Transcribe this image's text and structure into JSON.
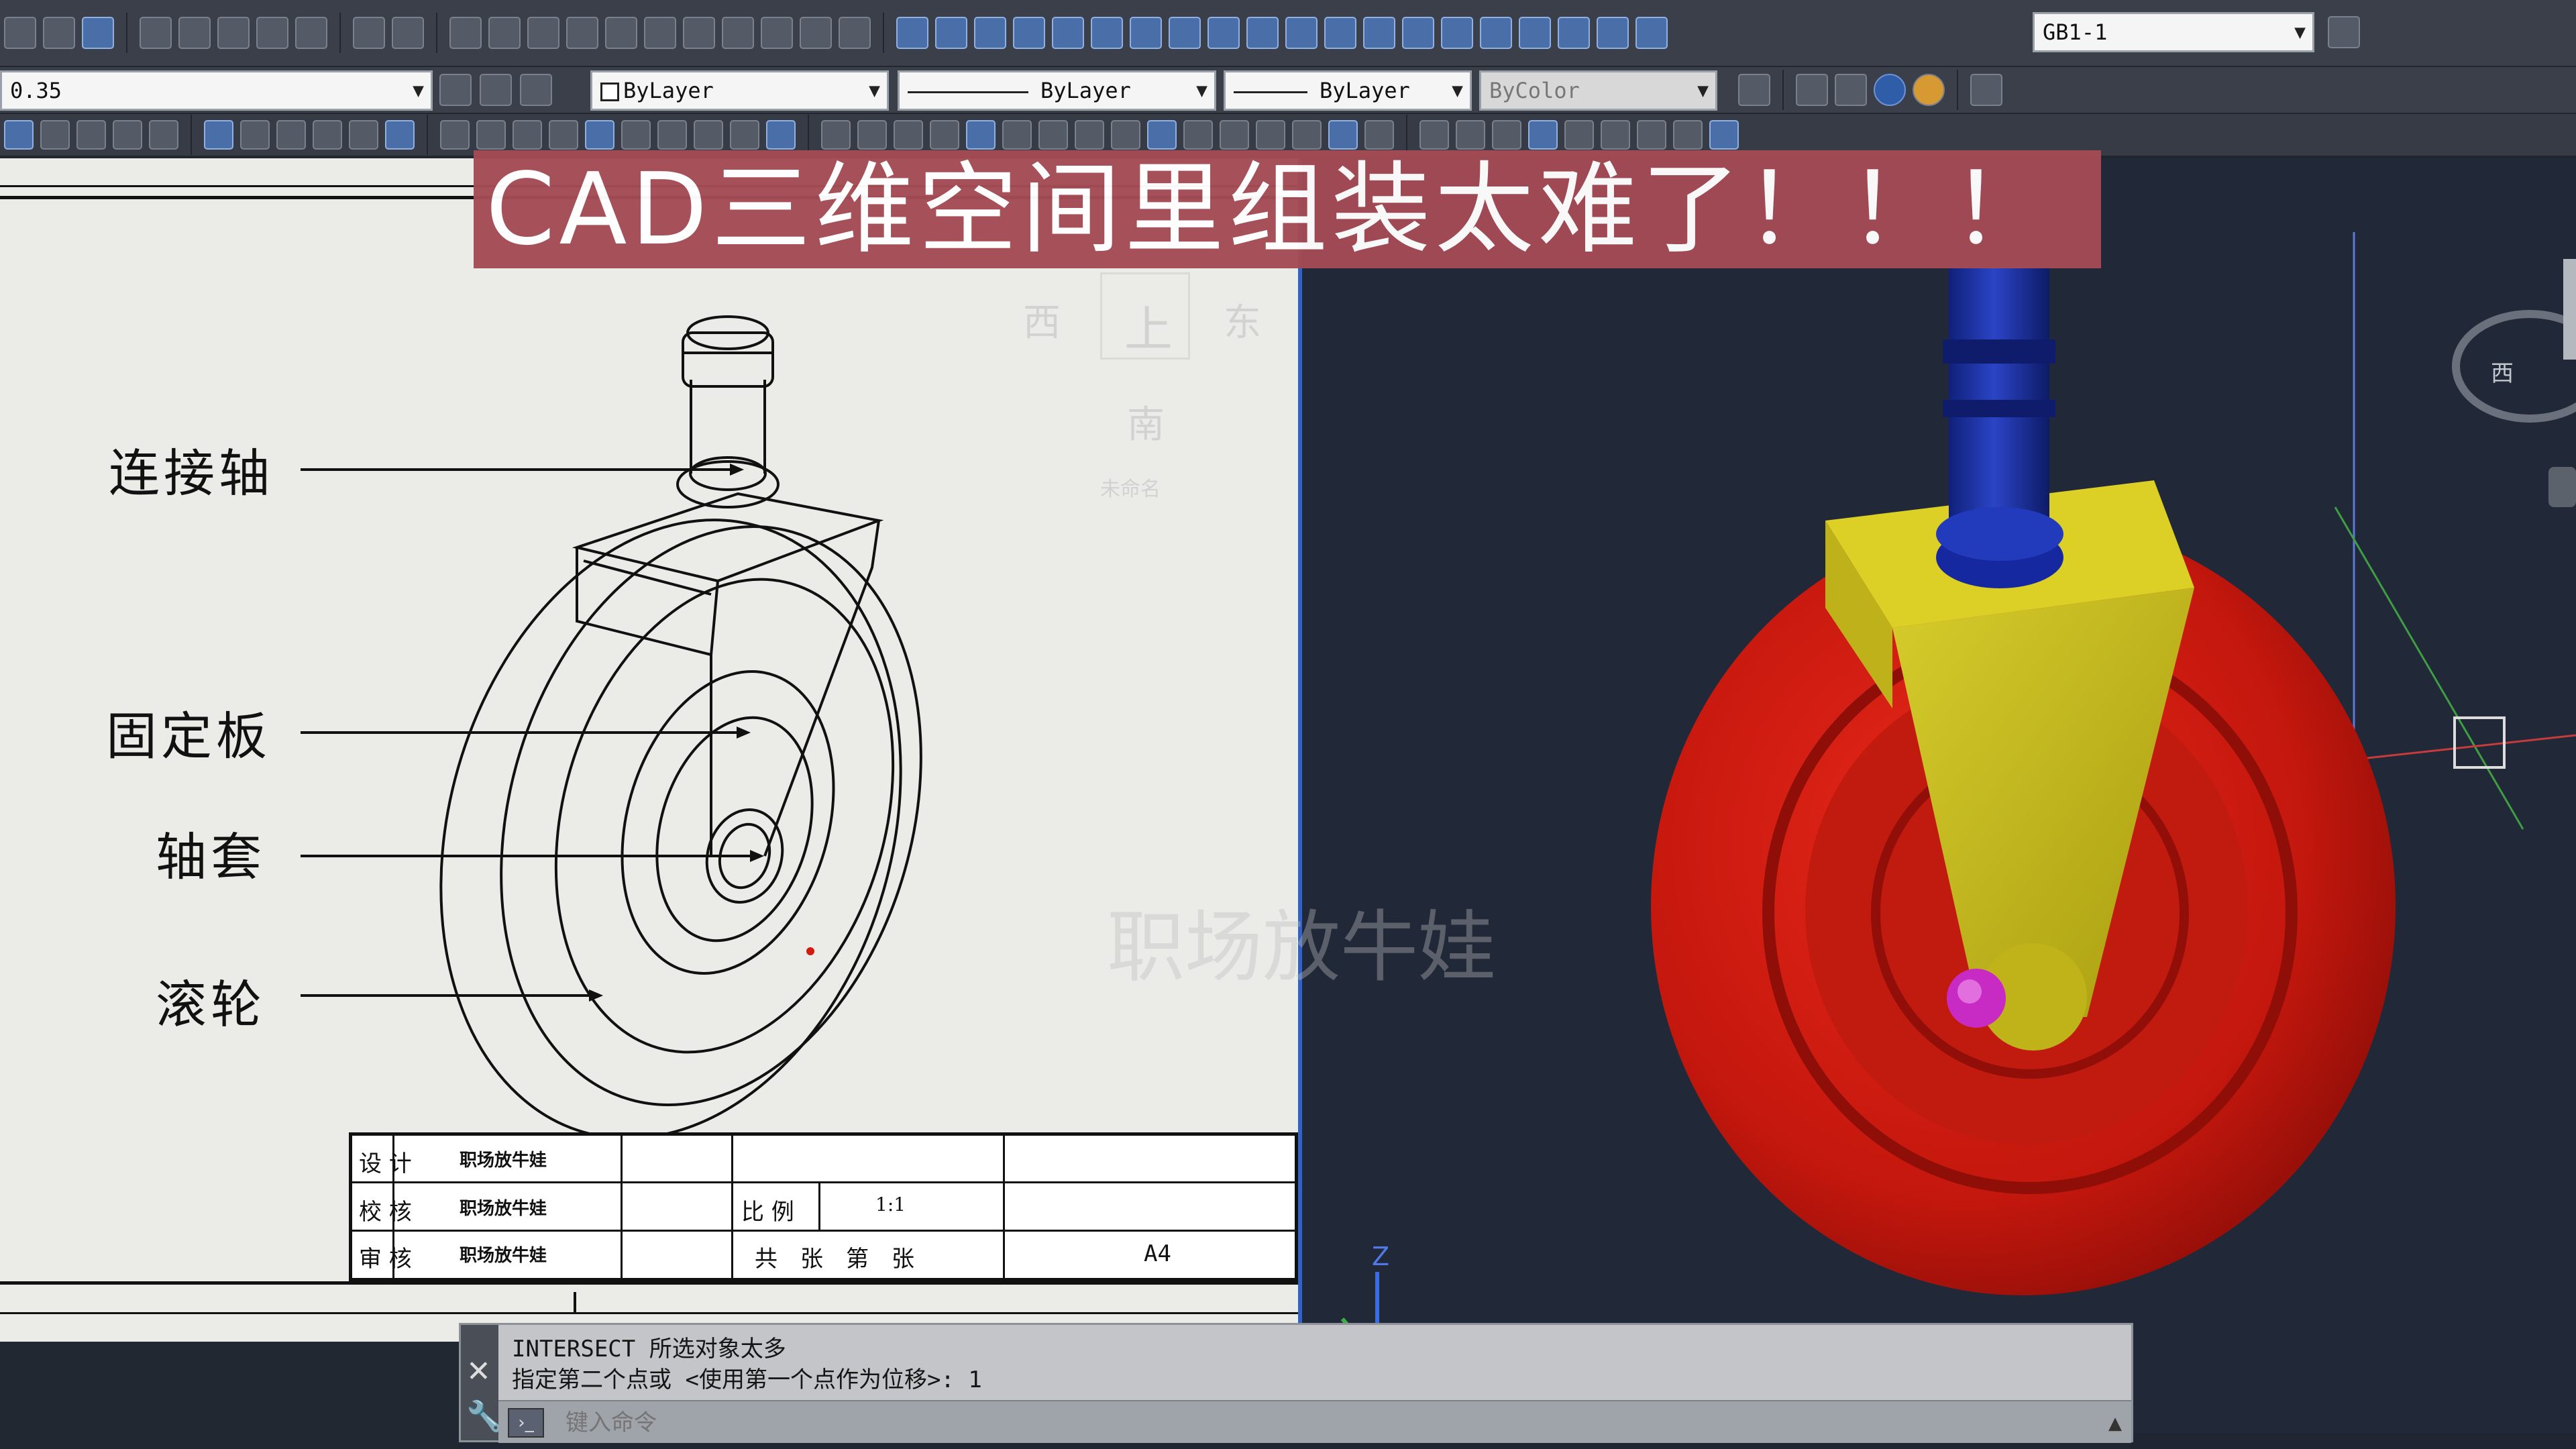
{
  "toolbar": {
    "lineweight_value": "0.35",
    "layer_value": "ByLayer",
    "linetype_value": "ByLayer",
    "lineweight_combo_value": "ByLayer",
    "plotstyle_value": "ByColor",
    "dimstyle_value": "GB1-1"
  },
  "banner": {
    "text": "CAD三维空间里组装太难了！！！"
  },
  "drawing": {
    "callouts": [
      "连接轴",
      "固定板",
      "轴套",
      "滚轮"
    ],
    "viewcube": {
      "west": "西",
      "top": "上",
      "east": "东",
      "south": "南",
      "unnamed": "未命名"
    },
    "titleblock": {
      "design_label": "设 计",
      "check_label": "校 核",
      "review_label": "审 核",
      "design_name": "职场放牛娃",
      "check_name": "职场放牛娃",
      "review_name": "职场放牛娃",
      "scale_label": "比 例",
      "scale_value": "1:1",
      "sheets_text": "共　张　第　张",
      "paper_size": "A4"
    }
  },
  "model": {
    "viewcube_west": "西",
    "ucs_z": "Z",
    "colors": {
      "wheel": "#d01c10",
      "bracket": "#c8bd1c",
      "shaft": "#1a2fa3",
      "bushing": "#c82ac4",
      "background": "#212837"
    }
  },
  "watermark": "职场放牛娃",
  "command": {
    "history_line1": "INTERSECT 所选对象太多",
    "history_line2": "指定第二个点或 <使用第一个点作为位移>: 1",
    "input_placeholder": "键入命令"
  }
}
